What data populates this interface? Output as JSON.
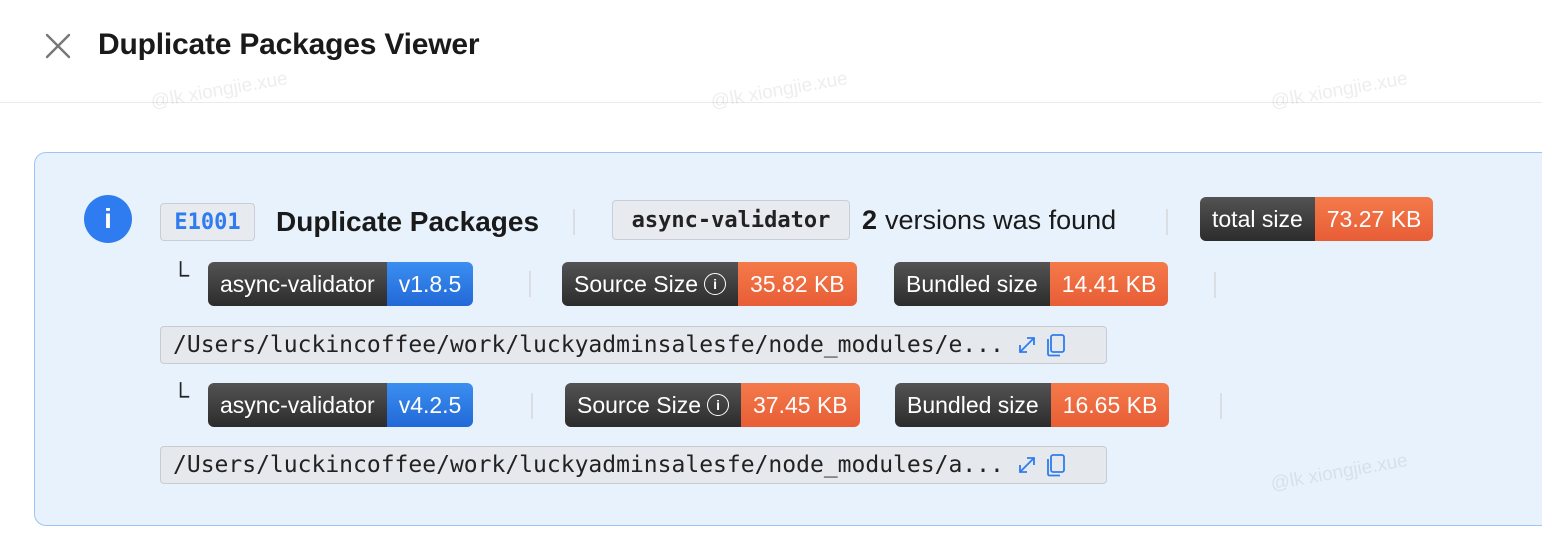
{
  "header": {
    "title": "Duplicate Packages Viewer"
  },
  "watermark": "@lk xiongjie.xue",
  "alert": {
    "code": "E1001",
    "title": "Duplicate Packages",
    "package": "async-validator",
    "versions_count": "2",
    "versions_text": "versions was found",
    "total_size_label": "total size",
    "total_size": "73.27 KB",
    "tree_glyph": "└",
    "source_size_label": "Source Size",
    "bundled_size_label": "Bundled size",
    "entries": [
      {
        "name": "async-validator",
        "version": "v1.8.5",
        "source_size": "35.82 KB",
        "bundled_size": "14.41 KB",
        "path": "/Users/luckincoffee/work/luckyadminsalesfe/node_modules/e..."
      },
      {
        "name": "async-validator",
        "version": "v4.2.5",
        "source_size": "37.45 KB",
        "bundled_size": "16.65 KB",
        "path": "/Users/luckincoffee/work/luckyadminsalesfe/node_modules/a..."
      }
    ]
  },
  "colors": {
    "accent_blue": "#2f7cf0",
    "size_orange": "#ee6a40",
    "panel_bg": "#e7f2fc",
    "panel_border": "#9cc6f0"
  }
}
